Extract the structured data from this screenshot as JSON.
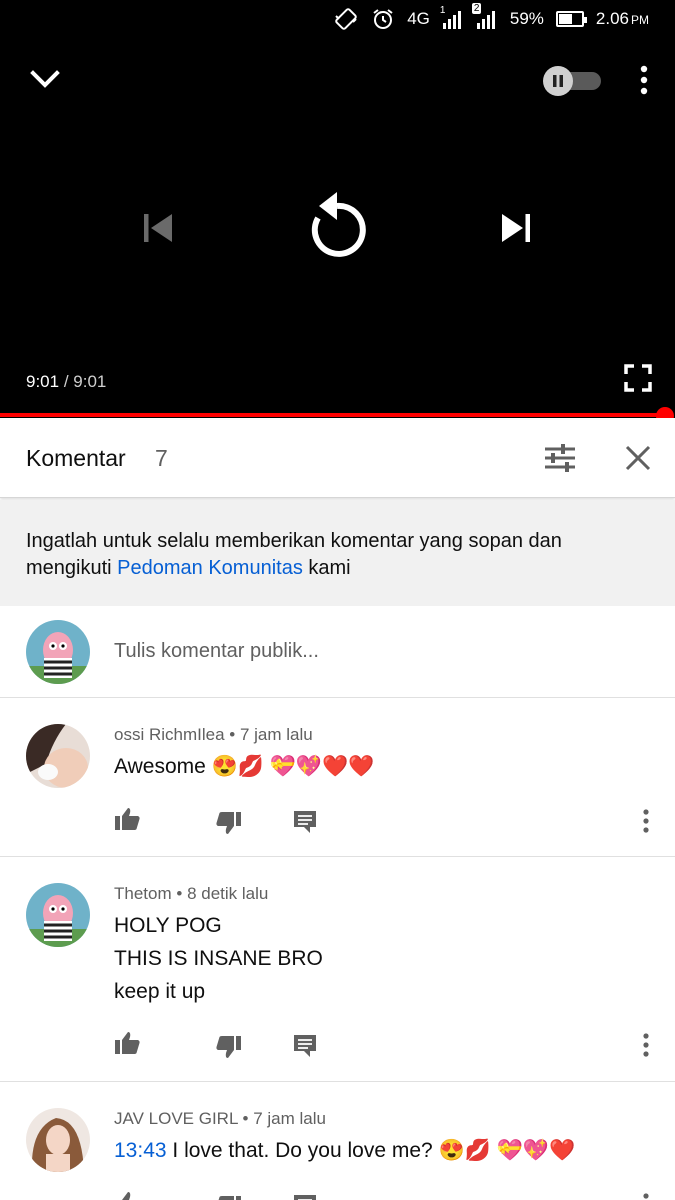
{
  "status_bar": {
    "network": "4G",
    "sim1_label": "1",
    "sim2_label": "2",
    "battery": "59%",
    "battery_level": 0.59,
    "time": "2.06",
    "ampm": "PM"
  },
  "player": {
    "current_time": "9:01",
    "separator": "/",
    "duration": "9:01",
    "progress": 1.0,
    "accent_color": "#ff0000"
  },
  "comments_header": {
    "title": "Komentar",
    "count": "7"
  },
  "notice": {
    "text_before": "Ingatlah untuk selalu memberikan komentar yang sopan dan mengikuti ",
    "link": "Pedoman Komunitas",
    "text_after": " kami"
  },
  "compose": {
    "placeholder": "Tulis komentar publik..."
  },
  "comments": [
    {
      "author": "ossi RichmIlea",
      "age": "7 jam lalu",
      "timestamp_link": "",
      "text": "Awesome 😍💋 💝💖❤️❤️"
    },
    {
      "author": "Thetom",
      "age": "8 detik lalu",
      "timestamp_link": "",
      "lines": [
        "HOLY POG",
        "THIS IS INSANE BRO",
        "keep it up"
      ]
    },
    {
      "author": "JAV LOVE GIRL",
      "age": "7 jam lalu",
      "timestamp_link": "13:43",
      "text": " I love that. Do you love me? 😍💋 💝💖❤️"
    }
  ],
  "icons": {
    "collapse": "chevron-down-icon",
    "autoplay": "autoplay-toggle-icon",
    "more": "more-vert-icon",
    "previous": "skip-previous-icon",
    "replay": "replay-icon",
    "next": "skip-next-icon",
    "fullscreen": "fullscreen-icon",
    "sort": "sort-tune-icon",
    "close": "close-icon",
    "like": "thumb-up-icon",
    "dislike": "thumb-down-icon",
    "reply": "reply-comment-icon"
  }
}
